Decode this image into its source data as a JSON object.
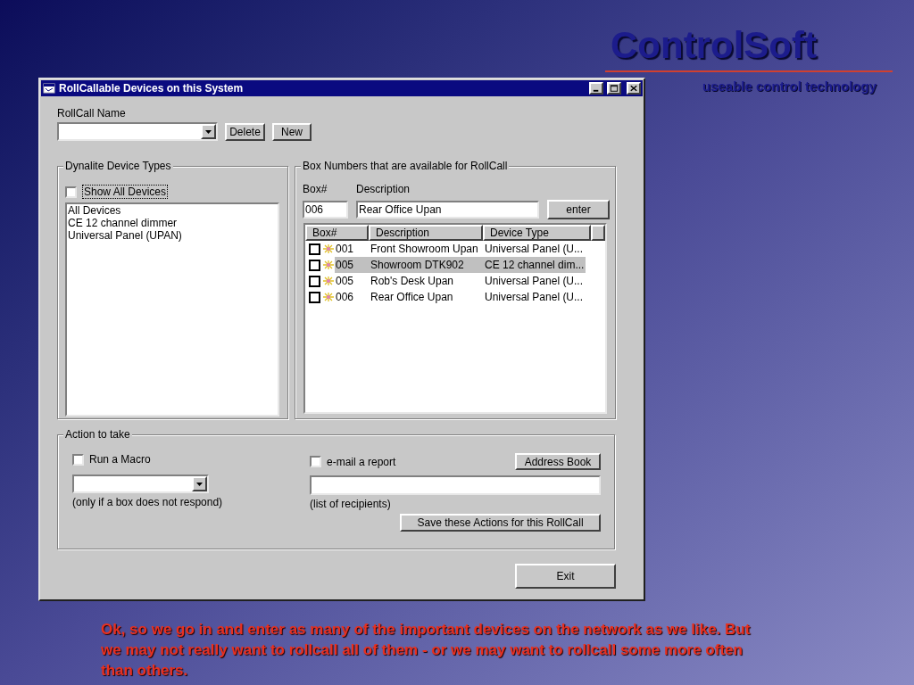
{
  "brand": {
    "name": "ControlSoft",
    "tagline": "useable control technology"
  },
  "window": {
    "title": "RollCallable Devices on this System"
  },
  "rollcall": {
    "label": "RollCall Name",
    "buttons": [
      "Delete",
      "New"
    ]
  },
  "device_types": {
    "title": "Dynalite Device Types",
    "show_all": {
      "label": "Show All Devices",
      "checked": false,
      "focused": true
    },
    "items": [
      "All Devices",
      "CE 12 channel dimmer",
      "Universal Panel (UPAN)"
    ]
  },
  "box_numbers": {
    "title": "Box Numbers that are available for RollCall",
    "box_label": "Box#",
    "description_label": "Description",
    "box_value": "006",
    "description_value": "Rear Office Upan",
    "enter_button": "enter",
    "table": {
      "columns": [
        "Box#",
        "Description",
        "Device Type"
      ],
      "rows": [
        {
          "checked": false,
          "selected": false,
          "cells": [
            "001",
            "Front Showroom Upan",
            "Universal Panel (U..."
          ]
        },
        {
          "checked": false,
          "selected": true,
          "cells": [
            "005",
            "Showroom DTK902",
            "CE 12 channel dim..."
          ]
        },
        {
          "checked": false,
          "selected": false,
          "cells": [
            "005",
            "Rob's Desk Upan",
            "Universal Panel (U..."
          ]
        },
        {
          "checked": false,
          "selected": false,
          "cells": [
            "006",
            "Rear Office Upan",
            "Universal Panel (U..."
          ]
        }
      ]
    }
  },
  "actions": {
    "title": "Action to take",
    "run_macro": {
      "label": "Run a Macro",
      "checked": false
    },
    "macro_hint": "(only if a box does not respond)",
    "email": {
      "label": "e-mail a report",
      "checked": false
    },
    "address_book_button": "Address Book",
    "recipients_hint": "(list of recipients)",
    "save_button": "Save these Actions for this RollCall"
  },
  "exit_button": "Exit",
  "caption": "Ok, so we go in and enter as many of the important devices on the network as we like. But we may not really want to rollcall all of them - or we may want to rollcall some more often than others."
}
